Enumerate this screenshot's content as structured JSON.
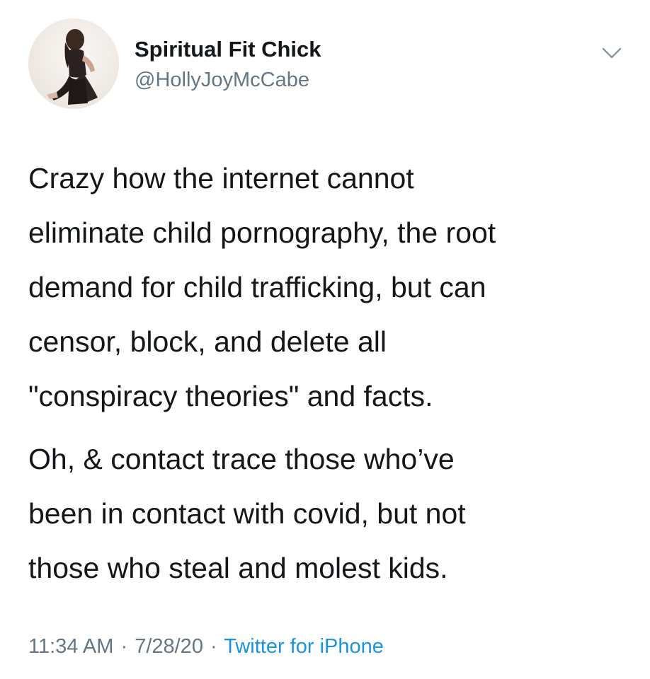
{
  "tweet": {
    "display_name": "Spiritual Fit Chick",
    "handle": "@HollyJoyMcCabe",
    "paragraphs": [
      [
        "Crazy how the internet cannot",
        "eliminate child pornography, the root",
        "demand for child trafficking, but can",
        "censor, block, and delete all",
        "\"conspiracy theories\" and facts."
      ],
      [
        "Oh, & contact trace those who’ve",
        "been in contact with covid, but not",
        "those who steal and molest kids."
      ]
    ],
    "time": "11:34 AM",
    "date": "7/28/20",
    "separator": "·",
    "source": "Twitter for iPhone"
  },
  "icons": {
    "avatar": "profile-photo",
    "caret": "chevron-down-icon"
  },
  "colors": {
    "text": "#14171a",
    "muted": "#657786",
    "link": "#1b95e0",
    "background": "#ffffff"
  }
}
